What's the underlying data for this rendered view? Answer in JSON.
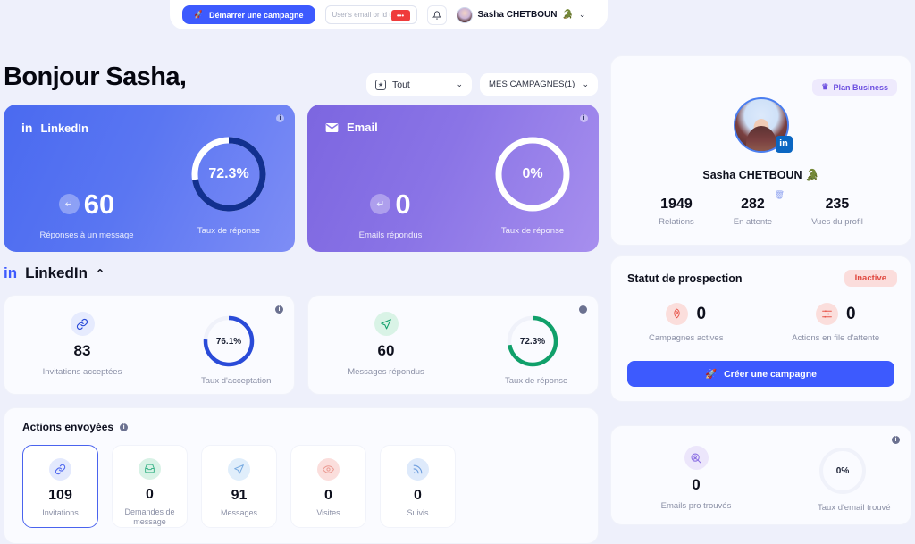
{
  "header": {
    "campaign_button": "Démarrer une campagne",
    "rocket_icon": "rocket-icon",
    "search_placeholder": "User's email or id to login",
    "search_value": "",
    "redacted_text": "•••",
    "bell_icon": "bell-icon",
    "user_name": "Sasha CHETBOUN",
    "user_emoji": "🐊",
    "chevron": "⌄"
  },
  "greeting": "Bonjour Sasha,",
  "filters": {
    "period": {
      "label": "Tout",
      "icon": "calendar-icon",
      "caret": "⌄"
    },
    "campaigns": {
      "label": "MES CAMPAGNES(1)",
      "caret": "⌄"
    }
  },
  "channels": [
    {
      "id": "linkedin",
      "title": "LinkedIn",
      "icon": "linkedin-icon",
      "metric_value": "60",
      "metric_label": "Réponses à un message",
      "rate_value": "72.3%",
      "rate_percent": 72.3,
      "rate_label": "Taux de réponse",
      "arc_color": "#12308f",
      "track_color": "#ffffff",
      "info_icon": "info-icon"
    },
    {
      "id": "email",
      "title": "Email",
      "icon": "envelope-icon",
      "metric_value": "0",
      "metric_label": "Emails répondus",
      "rate_value": "0%",
      "rate_percent": 0,
      "rate_label": "Taux de réponse",
      "arc_color": "#ffffff",
      "track_color": "#ffffff",
      "info_icon": "info-icon"
    }
  ],
  "linkedin_section": {
    "title": "LinkedIn",
    "caret": "⌃",
    "cards": [
      {
        "id": "invitations",
        "icon": "link-icon",
        "value": "83",
        "label": "Invitations acceptées",
        "rate_value": "76.1%",
        "rate_percent": 76.1,
        "rate_label": "Taux d'acceptation",
        "arc_color": "#2a4bd8",
        "track_color": "#f0f2fa"
      },
      {
        "id": "messages",
        "icon": "send-icon",
        "value": "60",
        "label": "Messages répondus",
        "rate_value": "72.3%",
        "rate_percent": 72.3,
        "rate_label": "Taux de réponse",
        "arc_color": "#10a06a",
        "track_color": "#f0f2fa"
      }
    ]
  },
  "actions_sent": {
    "title": "Actions envoyées",
    "info_icon": "info-icon",
    "tiles": [
      {
        "icon": "link-icon",
        "icon_style": "t-blue",
        "value": "109",
        "label": "Invitations",
        "active": true
      },
      {
        "icon": "inbox-icon",
        "icon_style": "t-green",
        "value": "0",
        "label": "Demandes de message",
        "active": false
      },
      {
        "icon": "send-icon",
        "icon_style": "t-cyan",
        "value": "91",
        "label": "Messages",
        "active": false
      },
      {
        "icon": "eye-icon",
        "icon_style": "t-red",
        "value": "0",
        "label": "Visites",
        "active": false
      },
      {
        "icon": "rss-icon",
        "icon_style": "t-lblue",
        "value": "0",
        "label": "Suivis",
        "active": false
      }
    ]
  },
  "profile": {
    "plan_badge": "Plan Business",
    "crown_icon": "crown-icon",
    "avatar_icon": "avatar",
    "linkedin_badge": "in",
    "name": "Sasha CHETBOUN",
    "emoji": "🐊",
    "stats": [
      {
        "value": "1949",
        "label": "Relations",
        "trash": false
      },
      {
        "value": "282",
        "label": "En attente",
        "trash": true
      },
      {
        "value": "235",
        "label": "Vues du profil",
        "trash": false
      }
    ],
    "trash_icon": "trash-icon"
  },
  "prospection": {
    "title": "Statut de prospection",
    "status": "Inactive",
    "stats": [
      {
        "icon": "rocket-icon",
        "value": "0",
        "label": "Campagnes actives"
      },
      {
        "icon": "queue-icon",
        "value": "0",
        "label": "Actions en file d'attente"
      }
    ],
    "button": "Créer une campagne",
    "button_icon": "rocket-icon"
  },
  "email_stats": {
    "info_icon": "info-icon",
    "icon": "search-person-icon",
    "value": "0",
    "label": "Emails pro trouvés",
    "rate_value": "0%",
    "rate_percent": 0,
    "rate_label": "Taux d'email trouvé",
    "track_color": "#f0f2fa"
  },
  "colors": {
    "accent": "#3d5afe",
    "linkedin": "#0a66c2",
    "danger": "#e0483f",
    "purple": "#6c4fe0",
    "green": "#10a06a",
    "page_bg": "#eef0fb"
  }
}
